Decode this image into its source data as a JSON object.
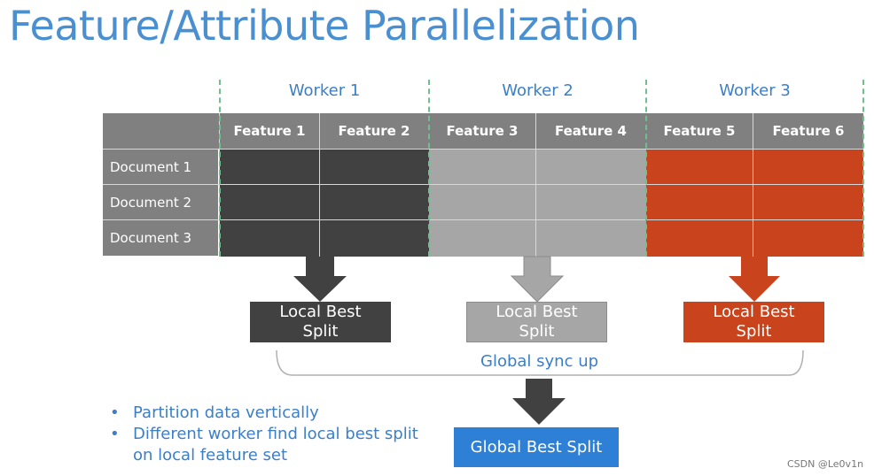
{
  "title": "Feature/Attribute Parallelization",
  "workers": [
    "Worker 1",
    "Worker 2",
    "Worker 3"
  ],
  "features": [
    "Feature 1",
    "Feature 2",
    "Feature 3",
    "Feature 4",
    "Feature 5",
    "Feature 6"
  ],
  "documents": [
    "Document 1",
    "Document 2",
    "Document 3"
  ],
  "local_split": {
    "w1": [
      "Local Best",
      "Split"
    ],
    "w2": [
      "Local Best",
      "Split"
    ],
    "w3": [
      "Local Best",
      "Split"
    ]
  },
  "global_sync": "Global sync up",
  "global_split": "Global Best Split",
  "bullets": [
    "Partition data vertically",
    "Different worker find local best split",
    "on local feature set"
  ],
  "bullet_glyph": "•",
  "watermark": "CSDN @Le0v1n",
  "colors": {
    "worker1": "#414141",
    "worker2": "#a6a6a6",
    "worker3": "#c9441c",
    "global": "#2e7fd6",
    "accent": "#3a7fc8"
  }
}
